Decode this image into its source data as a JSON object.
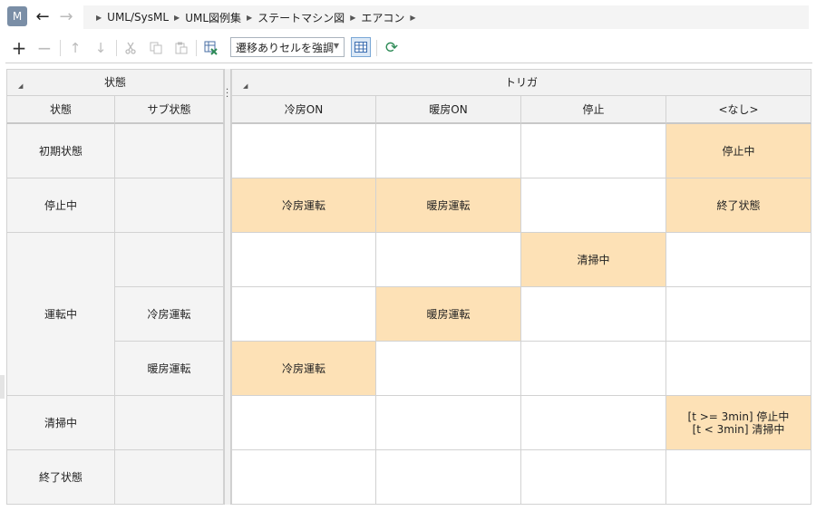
{
  "app": {
    "badge": "M"
  },
  "nav": {
    "back": "←",
    "forward": "→"
  },
  "breadcrumb": [
    "UML/SysML",
    "UML図例集",
    "ステートマシン図",
    "エアコン"
  ],
  "toolbar": {
    "highlight_select": "遷移ありセルを強調",
    "icons": [
      "add-icon",
      "remove-icon",
      "move-up-icon",
      "move-down-icon",
      "cut-icon",
      "copy-icon",
      "paste-icon",
      "export-icon",
      "grid-view-icon",
      "refresh-icon"
    ]
  },
  "colors": {
    "highlight": "#fde1b6",
    "header": "#f2f2f2",
    "accent": "#2e8b57"
  },
  "table": {
    "state_group": "状態",
    "trigger_group": "トリガ",
    "state_col": "状態",
    "substate_col": "サブ状態",
    "triggers": [
      "冷房ON",
      "暖房ON",
      "停止",
      "<なし>"
    ],
    "rows": [
      {
        "state": "初期状態",
        "sub": "",
        "cells": [
          "",
          "",
          "",
          "停止中"
        ]
      },
      {
        "state": "停止中",
        "sub": "",
        "cells": [
          "冷房運転",
          "暖房運転",
          "",
          "終了状態"
        ]
      },
      {
        "state": "運転中",
        "sub": "",
        "cells": [
          "",
          "",
          "清掃中",
          ""
        ]
      },
      {
        "state": "",
        "sub": "冷房運転",
        "cells": [
          "",
          "暖房運転",
          "",
          ""
        ]
      },
      {
        "state": "",
        "sub": "暖房運転",
        "cells": [
          "冷房運転",
          "",
          "",
          ""
        ]
      },
      {
        "state": "清掃中",
        "sub": "",
        "cells": [
          "",
          "",
          "",
          "[t >= 3min] 停止中\n[t < 3min] 清掃中"
        ]
      },
      {
        "state": "終了状態",
        "sub": "",
        "cells": [
          "",
          "",
          "",
          ""
        ]
      }
    ]
  }
}
